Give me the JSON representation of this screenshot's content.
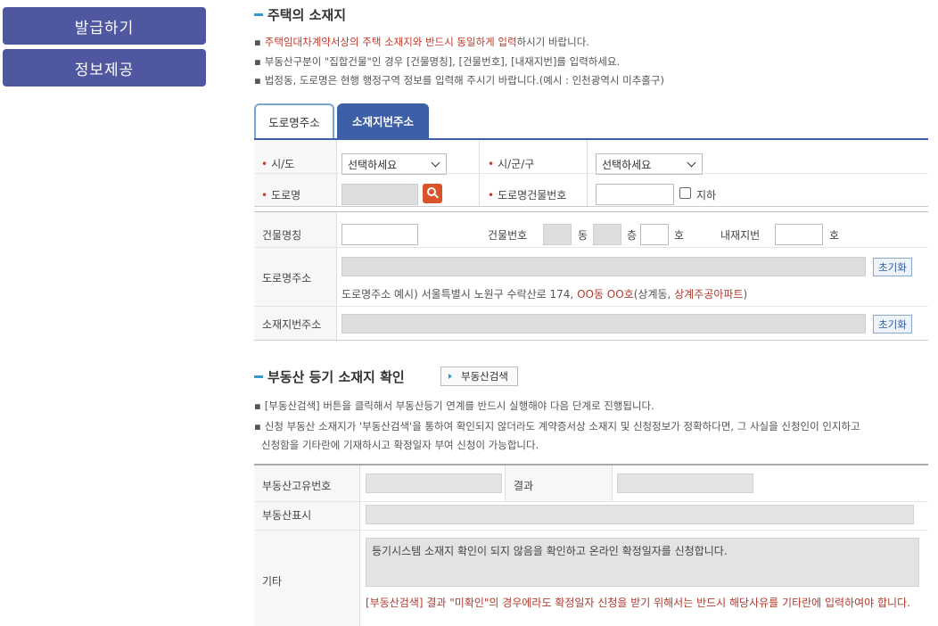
{
  "sidebar": {
    "issue_label": "발급하기",
    "info_label": "정보제공"
  },
  "address_section": {
    "title": "주택의 소재지",
    "notes": {
      "n1_red": "주택임대차계약서상의 주택 소재지와 반드시 동일하게 입력",
      "n1_tail": "하시기 바랍니다.",
      "n2": "부동산구분이 \"집합건물\"인 경우 [건물명칭], [건물번호], [내재지번]를 입력하세요.",
      "n3": "법정동, 도로명은 현행 행정구역 정보를 입력해 주시기 바랍니다.(예시 : 인천광역시 미추홀구)"
    },
    "bullet": "▪",
    "required_mark": "•",
    "tabs": {
      "road": "도로명주소",
      "lot": "소재지번주소"
    },
    "form": {
      "sido_label": "시/도",
      "sido_value": "선택하세요",
      "sigungu_label": "시/군/구",
      "sigungu_value": "선택하세요",
      "road_label": "도로명",
      "road_building_no_label": "도로명건물번호",
      "basement_label": "지하",
      "building_name_label": "건물명칭",
      "building_no_label": "건물번호",
      "dong_unit": "동",
      "floor_unit": "층",
      "ho_unit": "호",
      "inner_lot_label": "내재지번",
      "inner_ho_unit": "호",
      "road_address_label": "도로명주소",
      "reset_label": "초기화",
      "example_prefix": "도로명주소 예시) 서울특별시 노원구 수락산로 174,",
      "example_red1": "OO동 OO호",
      "example_mid": "(상계동,",
      "example_red2": "상계주공아파트",
      "example_suffix": ")",
      "lot_address_label": "소재지번주소",
      "reset_label2": "초기화"
    }
  },
  "registry_section": {
    "title": "부동산 등기 소재지 확인",
    "search_button": "부동산검색",
    "notes": {
      "n1": "[부동산검색] 버튼을 클릭해서 부동산등기 연계를 반드시 실행해야 다음 단계로 진행됩니다.",
      "n2_line1": "신청 부동산 소재지가 '부동산검색'을 통하여 확인되지 않더라도 계약증서상 소재지 및 신청정보가 정확하다면, 그 사실을 신청인이 인지하고",
      "n2_line2": "신청함을 기타란에 기재하시고 확정일자 부여 신청이 가능합니다."
    },
    "table": {
      "unique_no_label": "부동산고유번호",
      "result_label": "결과",
      "display_label": "부동산표시",
      "etc_label": "기타",
      "etc_value": "등기시스템 소재지 확인이 되지 않음을 확인하고 온라인 확정일자를 신청합니다.",
      "warning": "[부동산검색] 결과 \"미확인\"의 경우에라도 확정일자 신청을 받기 위해서는 반드시 해당사유를 기타란에 입력하여야 합니다."
    }
  },
  "colors": {
    "sidebar_bg": "#4f57a0",
    "accent_blue": "#2e9bd6",
    "required_red": "#d9342b",
    "tab_inactive": "#3d5fa8"
  }
}
